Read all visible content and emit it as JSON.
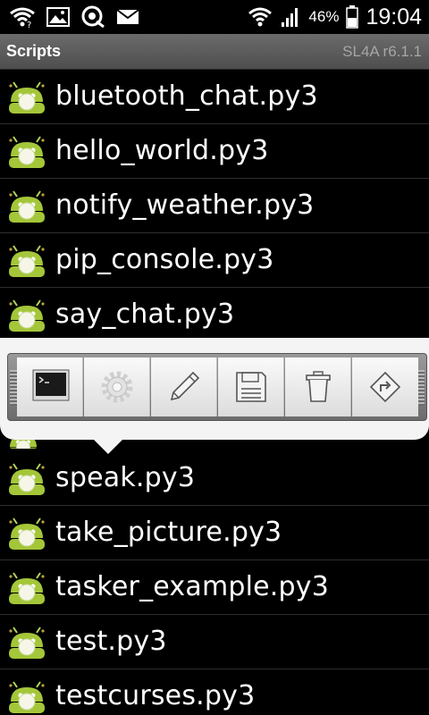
{
  "status_bar": {
    "icons": [
      "wifi-signal-icon",
      "image-notification-icon",
      "sync-notification-icon",
      "email-notification-icon",
      "wifi-icon",
      "cell-signal-icon",
      "battery-icon"
    ],
    "battery_percent": "46%",
    "time": "19:04"
  },
  "header": {
    "title": "Scripts",
    "version": "SL4A r6.1.1"
  },
  "scripts": [
    {
      "name": "bluetooth_chat.py3"
    },
    {
      "name": "hello_world.py3"
    },
    {
      "name": "notify_weather.py3"
    },
    {
      "name": "pip_console.py3"
    },
    {
      "name": "say_chat.py3"
    },
    {
      "name": "speak.py3"
    },
    {
      "name": "take_picture.py3"
    },
    {
      "name": "tasker_example.py3"
    },
    {
      "name": "test.py3"
    },
    {
      "name": "testcurses.py3"
    }
  ],
  "quick_actions": [
    {
      "icon": "terminal-icon"
    },
    {
      "icon": "gear-icon"
    },
    {
      "icon": "pencil-icon"
    },
    {
      "icon": "save-icon"
    },
    {
      "icon": "trash-icon"
    },
    {
      "icon": "rename-icon"
    }
  ],
  "colors": {
    "background": "#000000",
    "titlebar": "#5a5a5a",
    "version_text": "#a6a6a6",
    "android_green": "#9dc03b",
    "popup_bg": "#f4f4f4"
  }
}
